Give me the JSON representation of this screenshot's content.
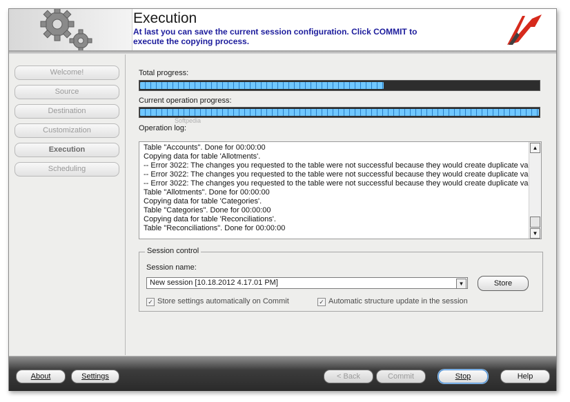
{
  "header": {
    "title": "Execution",
    "subtitle": "At last you can save the current session configuration. Click COMMIT to execute the copying  process.",
    "gear_icon": "gears-icon",
    "logo_icon": "app-logo-icon",
    "watermark": "Softpedia"
  },
  "sidebar": {
    "items": [
      {
        "label": "Welcome!",
        "active": false
      },
      {
        "label": "Source",
        "active": false
      },
      {
        "label": "Destination",
        "active": false
      },
      {
        "label": "Customization",
        "active": false
      },
      {
        "label": "Execution",
        "active": true
      },
      {
        "label": "Scheduling",
        "active": false
      }
    ]
  },
  "progress": {
    "total_label": "Total progress:",
    "total_value": 0.61,
    "current_label": "Current operation progress:",
    "current_value": 1.0
  },
  "log": {
    "label": "Operation log:",
    "lines": [
      "Table \"Accounts\". Done for 00:00:00",
      "Copying data for table 'Allotments'.",
      "-- Error 3022: The changes you requested to the table were not successful because they would create duplicate valu",
      "-- Error 3022: The changes you requested to the table were not successful because they would create duplicate valu",
      "-- Error 3022: The changes you requested to the table were not successful because they would create duplicate valu",
      "Table \"Allotments\". Done for 00:00:00",
      "Copying data for table 'Categories'.",
      "Table \"Categories\". Done for 00:00:00",
      "Copying data for table 'Reconciliations'.",
      "Table \"Reconciliations\". Done for 00:00:00"
    ]
  },
  "session": {
    "group_title": "Session control",
    "name_label": "Session name:",
    "name_value": "New session [10.18.2012 4.17.01 PM]",
    "store_label": "Store",
    "auto_store_label": "Store settings automatically on Commit",
    "auto_store_checked": true,
    "auto_structure_label": "Automatic structure update in the session",
    "auto_structure_checked": true
  },
  "footer": {
    "about": "About",
    "settings": "Settings",
    "back": "< Back",
    "commit": "Commit",
    "stop": "Stop",
    "help": "Help"
  },
  "colors": {
    "title_blue": "#1c1c9c",
    "progress_fill": "#6fc7ff",
    "logo_red": "#d62a1c"
  }
}
